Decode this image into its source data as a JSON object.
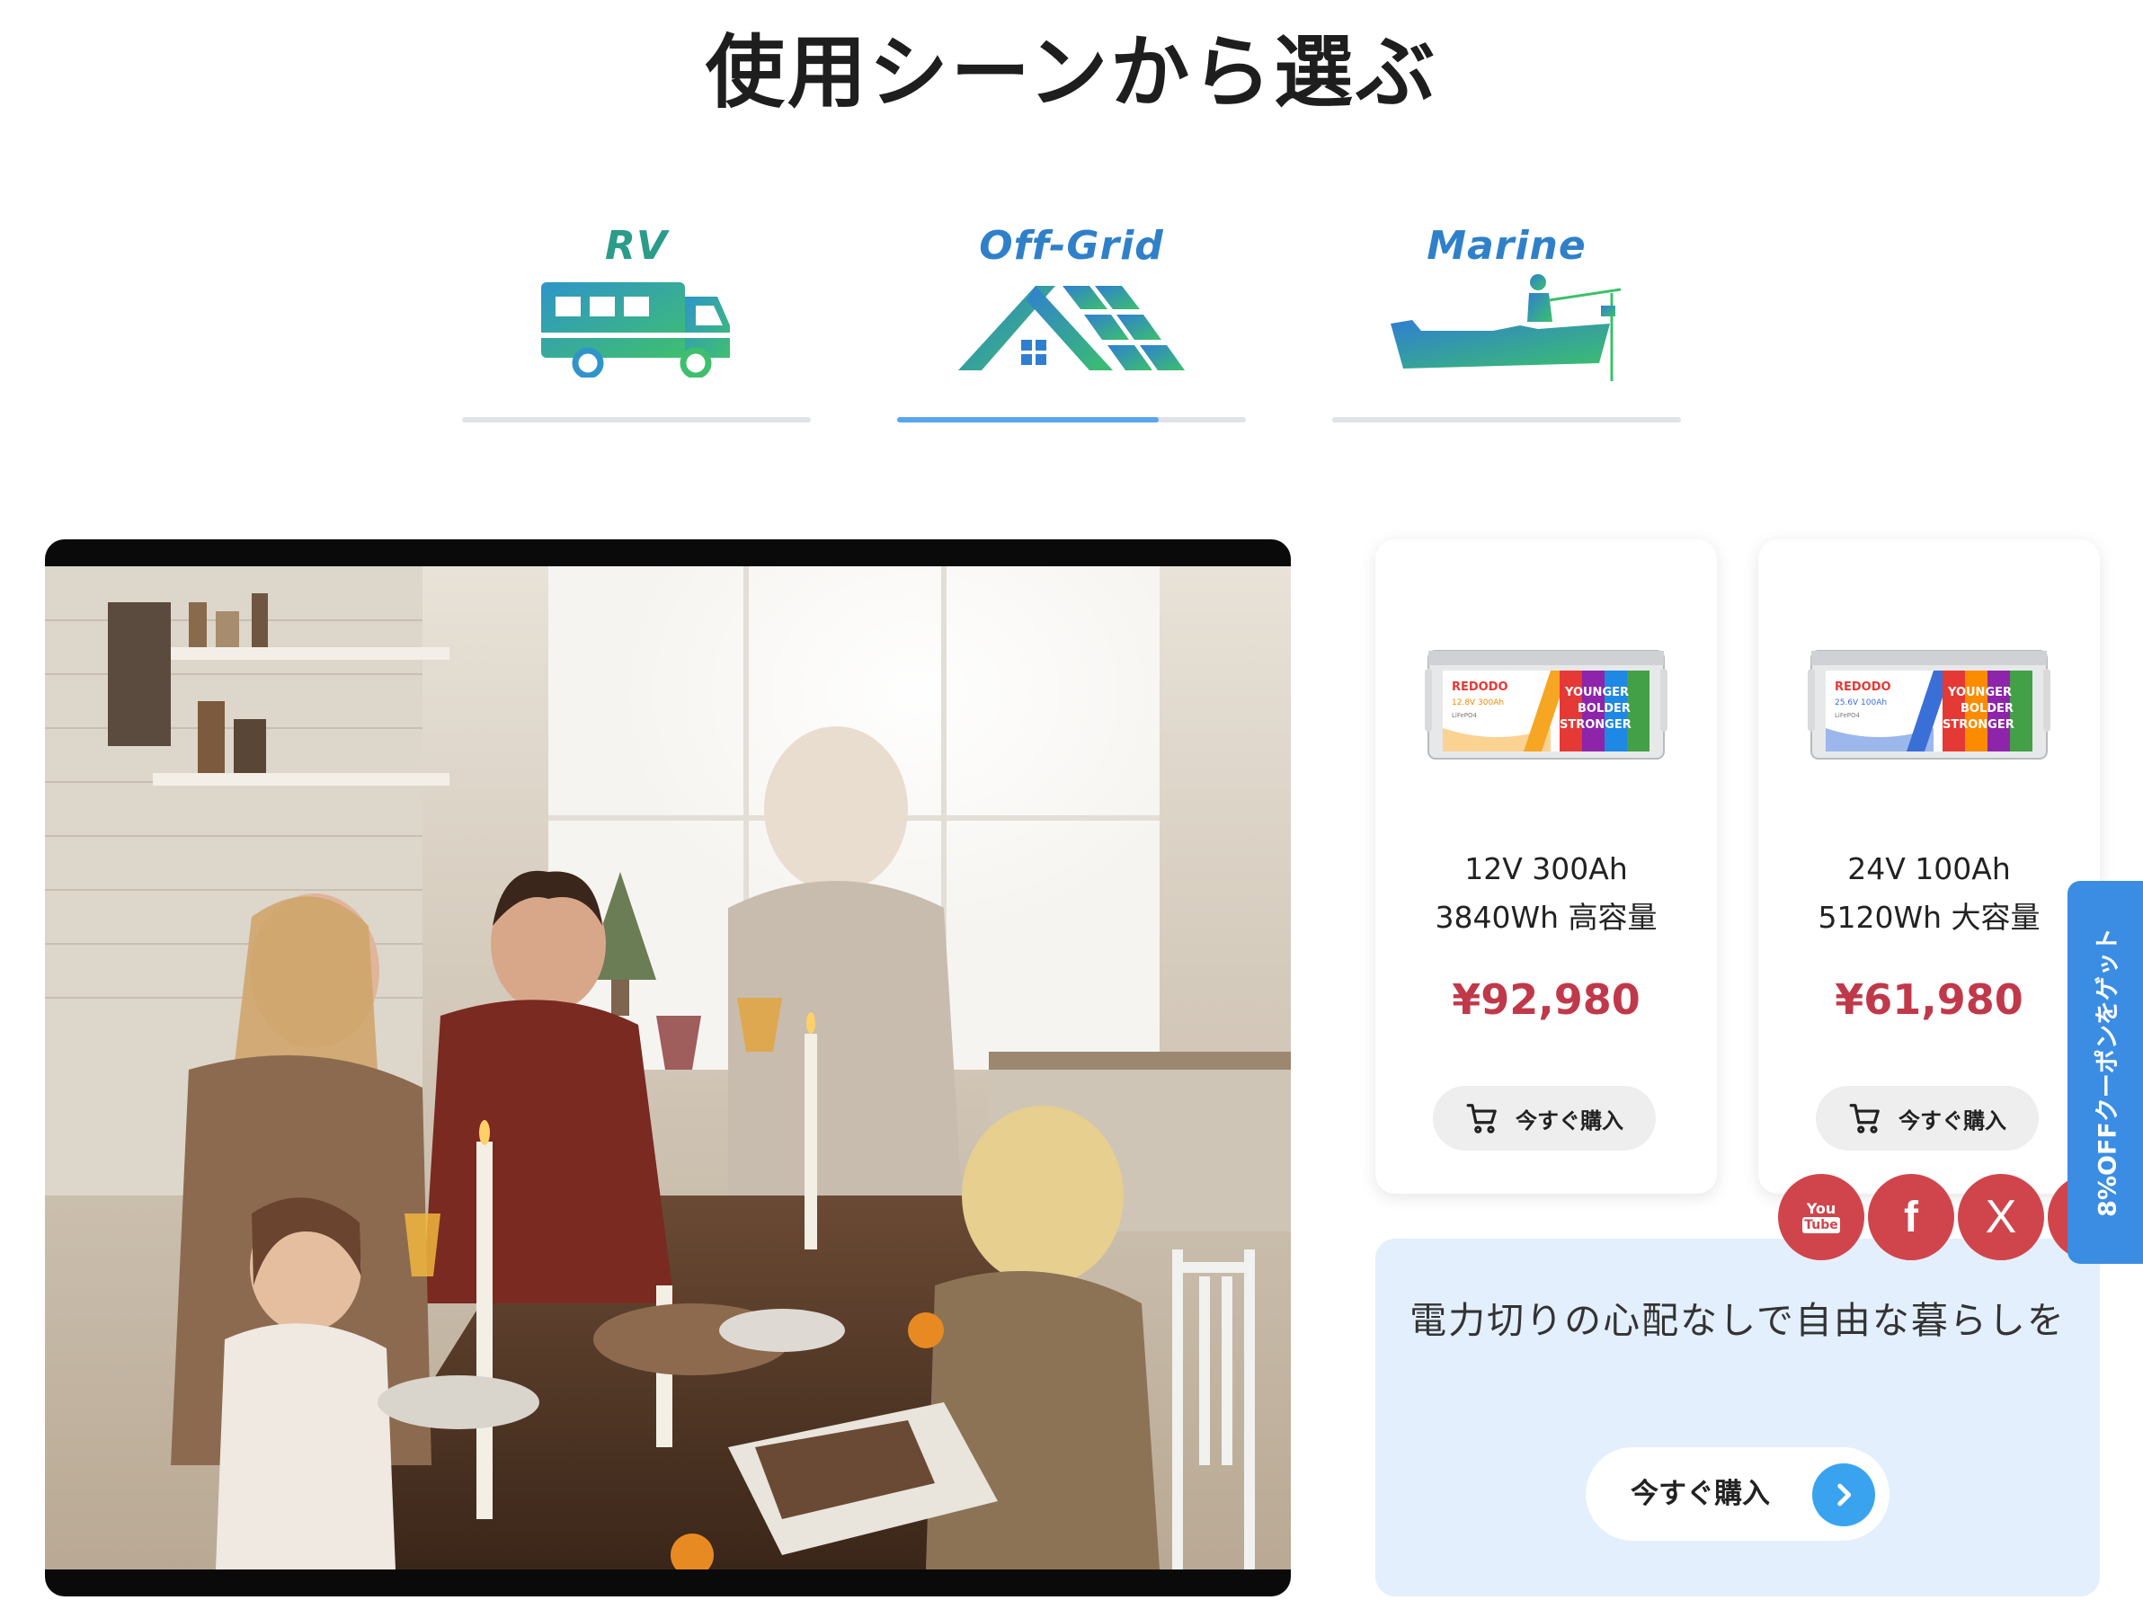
{
  "page": {
    "title": "使用シーンから選ぶ"
  },
  "tabs": [
    {
      "label": "RV",
      "icon": "rv-camper-icon",
      "active": false,
      "progress": 0
    },
    {
      "label": "Off-Grid",
      "icon": "solar-house-icon",
      "active": true,
      "progress": 0.75
    },
    {
      "label": "Marine",
      "icon": "fishing-boat-icon",
      "active": false,
      "progress": 0
    }
  ],
  "colors": {
    "price": "#c0394a",
    "tab_active": "#5aa6ee",
    "tab_inactive": "#e1e3e8",
    "promo_bg": "#e3effc",
    "social": "#d0454c",
    "coupon": "#3a8de3"
  },
  "video": {
    "description_icon": "family-dinner-video"
  },
  "products": [
    {
      "name_line1": "12V 300Ah",
      "name_line2": "3840Wh 高容量",
      "price": "¥92,980",
      "buy_label": "今すぐ購入",
      "image": {
        "brand": "REDODO",
        "badge": "12.8V 300Ah",
        "chem": "LiFePO4",
        "slogan1": "YOUNGER",
        "slogan2": "BOLDER",
        "slogan3": "STRONGER"
      }
    },
    {
      "name_line1": "24V 100Ah",
      "name_line2": "5120Wh 大容量",
      "price": "¥61,980",
      "buy_label": "今すぐ購入",
      "image": {
        "brand": "REDODO",
        "badge": "25.6V 100Ah",
        "chem": "LiFePO4",
        "slogan1": "YOUNGER",
        "slogan2": "BOLDER",
        "slogan3": "STRONGER"
      }
    }
  ],
  "promo": {
    "text": "電力切りの心配なしで自由な暮らしを",
    "button_label": "今すぐ購入"
  },
  "social": [
    {
      "name": "youtube-icon",
      "label_top": "You",
      "label_bottom": "Tube"
    },
    {
      "name": "facebook-icon",
      "label": "f"
    },
    {
      "name": "x-icon",
      "label": "X"
    }
  ],
  "coupon": {
    "label": "8%OFFクーポンをゲット"
  }
}
